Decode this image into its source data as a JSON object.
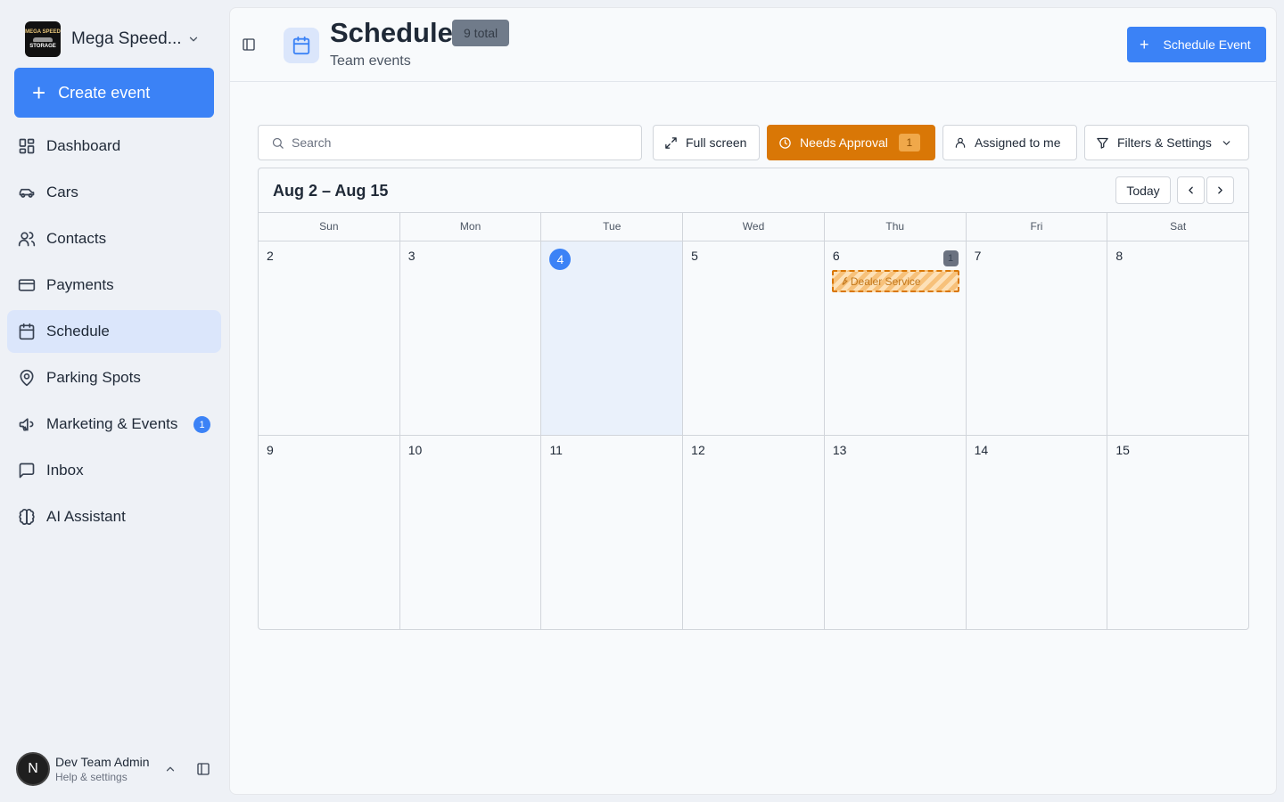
{
  "sidebar": {
    "brand": {
      "name": "Mega Speed...",
      "logo_line1": "MEGA SPEED",
      "logo_line2": "STORAGE"
    },
    "create_label": "Create event",
    "items": [
      {
        "label": "Dashboard",
        "icon": "dashboard-icon"
      },
      {
        "label": "Cars",
        "icon": "car-icon"
      },
      {
        "label": "Contacts",
        "icon": "users-icon"
      },
      {
        "label": "Payments",
        "icon": "credit-card-icon"
      },
      {
        "label": "Schedule",
        "icon": "calendar-icon",
        "active": true
      },
      {
        "label": "Parking Spots",
        "icon": "map-pin-icon"
      },
      {
        "label": "Marketing & Events",
        "icon": "megaphone-icon",
        "badge": "1"
      },
      {
        "label": "Inbox",
        "icon": "message-icon"
      },
      {
        "label": "AI Assistant",
        "icon": "brain-icon"
      }
    ],
    "user": {
      "initial": "N",
      "name": "Dev Team Admin",
      "sub": "Help & settings"
    }
  },
  "header": {
    "title": "Schedule",
    "total_badge": "9 total",
    "subtitle": "Team events",
    "schedule_button": "Schedule Event"
  },
  "toolbar": {
    "search_placeholder": "Search",
    "fullscreen_label": "Full screen",
    "approval_label": "Needs Approval",
    "approval_count": "1",
    "assigned_label": "Assigned to me",
    "filters_label": "Filters & Settings"
  },
  "calendar": {
    "range": "Aug 2 – Aug 15",
    "today_label": "Today",
    "weekdays": [
      "Sun",
      "Mon",
      "Tue",
      "Wed",
      "Thu",
      "Fri",
      "Sat"
    ],
    "week1": [
      "2",
      "3",
      "4",
      "5",
      "6",
      "7",
      "8"
    ],
    "week2": [
      "9",
      "10",
      "11",
      "12",
      "13",
      "14",
      "15"
    ],
    "today": "4",
    "events": [
      {
        "day": "6",
        "title": "Dealer Service",
        "count": "1",
        "status": "needs-approval"
      }
    ]
  },
  "colors": {
    "accent": "#3b82f6",
    "approval": "#d97706",
    "active_nav": "#dbe6fb"
  }
}
